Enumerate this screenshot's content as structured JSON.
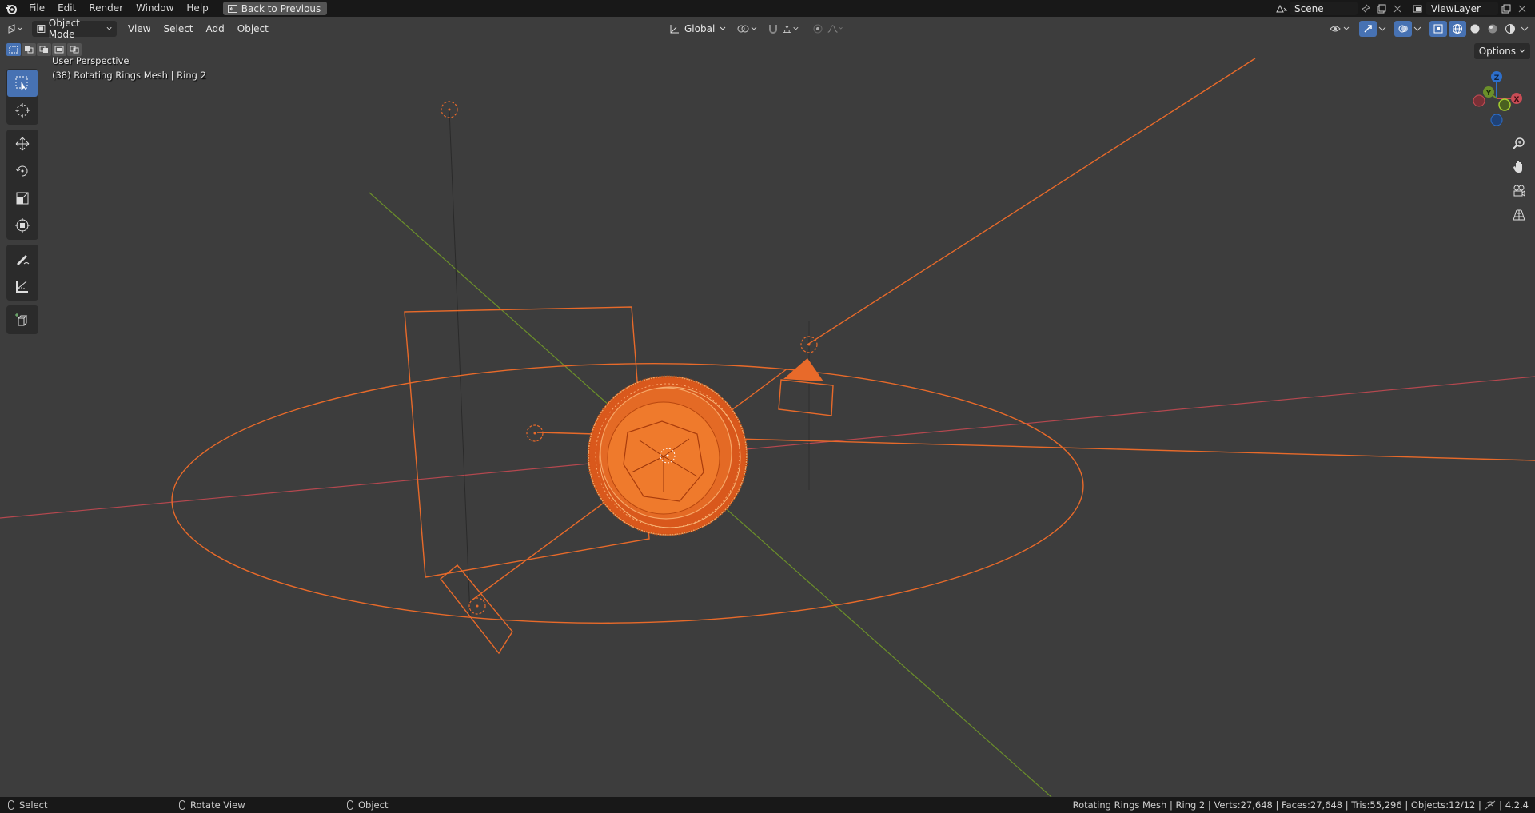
{
  "topbar": {
    "menus": [
      "File",
      "Edit",
      "Render",
      "Window",
      "Help"
    ],
    "back_button": "Back to Previous",
    "scene_name": "Scene",
    "view_layer": "ViewLayer"
  },
  "viewport_header": {
    "mode": "Object Mode",
    "menus": [
      "View",
      "Select",
      "Add",
      "Object"
    ],
    "transform_orientation": "Global",
    "options_label": "Options"
  },
  "viewport": {
    "perspective_label": "User Perspective",
    "active_object_label": "(38) Rotating Rings Mesh | Ring 2"
  },
  "gizmo": {
    "z": "Z",
    "y": "Y",
    "x": "X"
  },
  "statusbar": {
    "select": "Select",
    "rotate_view": "Rotate View",
    "object": "Object",
    "stats": "Rotating Rings Mesh | Ring 2 | Verts:27,648 | Faces:27,648 | Tris:55,296 | Objects:12/12 |",
    "version": "4.2.4"
  },
  "colors": {
    "accent": "#4772b3",
    "selection_orange": "#e86a2a",
    "x_axis": "#c94c55",
    "y_axis": "#6b8f2a",
    "z_axis": "#2d6fcc"
  }
}
